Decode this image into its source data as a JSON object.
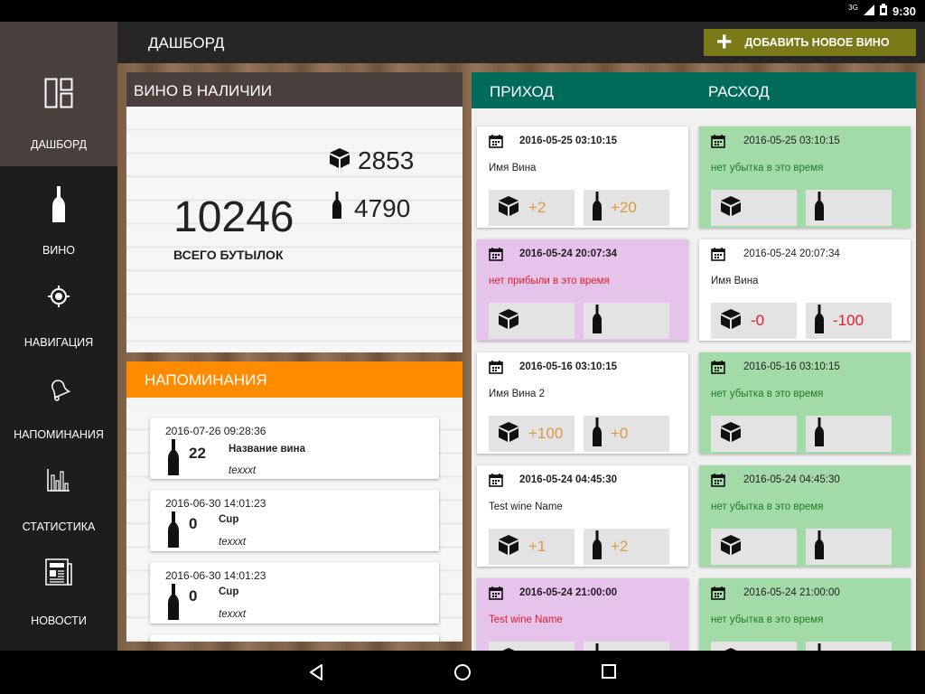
{
  "status_bar": {
    "network": "3G",
    "time": "9:30",
    "icons": [
      "signal-icon",
      "battery-icon"
    ]
  },
  "topbar": {
    "title": "ДАШБОРД",
    "add_label": "ДОБАВИТЬ НОВОЕ ВИНО"
  },
  "sidebar": {
    "items": [
      {
        "label": "ДАШБОРД",
        "icon": "dashboard-icon",
        "active": true
      },
      {
        "label": "ВИНО",
        "icon": "bottle-icon"
      },
      {
        "label": "НАВИГАЦИЯ",
        "icon": "target-icon"
      },
      {
        "label": "НАПОМИНАНИЯ",
        "icon": "bell-icon"
      },
      {
        "label": "СТАТИСТИКА",
        "icon": "bar-chart-icon"
      },
      {
        "label": "НОВОСТИ",
        "icon": "newspaper-icon"
      }
    ]
  },
  "stock": {
    "header": "ВИНО В НАЛИЧИИ",
    "total": "10246",
    "total_label": "ВСЕГО БУТЫЛОК",
    "boxes": "2853",
    "bottles": "4790"
  },
  "reminders": {
    "header": "НАПОМИНАНИЯ",
    "items": [
      {
        "date": "2016-07-26 09:28:36",
        "qty": "22",
        "name": "Название вина",
        "note": "texxxt"
      },
      {
        "date": "2016-06-30 14:01:23",
        "qty": "0",
        "name": "Cup",
        "note": "texxxt"
      },
      {
        "date": "2016-06-30 14:01:23",
        "qty": "0",
        "name": "Cup",
        "note": "texxxt"
      }
    ]
  },
  "flow": {
    "income_header": "ПРИХОД",
    "expense_header": "РАСХОД",
    "income": [
      {
        "date": "2016-05-25 03:10:15",
        "name": "Имя Вина",
        "box": "+2",
        "bottle": "+20"
      },
      {
        "date": "2016-05-24 20:07:34",
        "name": "нет прибыли в это время",
        "box": "",
        "bottle": ""
      },
      {
        "date": "2016-05-16 03:10:15",
        "name": "Имя Вина 2",
        "box": "+100",
        "bottle": "+0"
      },
      {
        "date": "2016-05-24 04:45:30",
        "name": "Test wine Name",
        "box": "+1",
        "bottle": "+2"
      },
      {
        "date": "2016-05-24 21:00:00",
        "name": "Test wine Name",
        "box": "",
        "bottle": ""
      }
    ],
    "expense": [
      {
        "date": "2016-05-25 03:10:15",
        "name": "нет убытка в это время",
        "box": "",
        "bottle": ""
      },
      {
        "date": "2016-05-24 20:07:34",
        "name": "Имя Вина",
        "box": "-0",
        "bottle": "-100"
      },
      {
        "date": "2016-05-16 03:10:15",
        "name": "нет убытка в это время",
        "box": "",
        "bottle": ""
      },
      {
        "date": "2016-05-24 04:45:30",
        "name": "нет убытка в это время",
        "box": "",
        "bottle": ""
      },
      {
        "date": "2016-05-24 21:00:00",
        "name": "нет убытка в это время",
        "box": "",
        "bottle": ""
      }
    ]
  },
  "colors": {
    "flow_header": "#006a5b",
    "reminder_header": "#ff8c00",
    "stock_header": "#4a3f3d",
    "add_button": "#7b7a19",
    "green_card": "#a3dba8",
    "pink_card": "#e6c3ea"
  }
}
